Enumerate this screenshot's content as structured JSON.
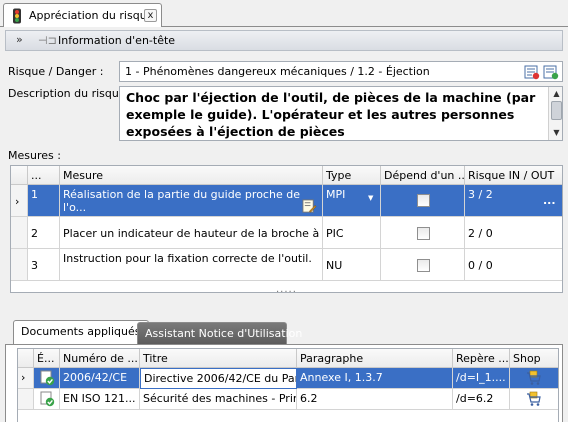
{
  "tab": {
    "title": "Appréciation du risque",
    "close": "x"
  },
  "header_section": {
    "label": "Information d'en-tête"
  },
  "risk": {
    "label": "Risque / Danger :",
    "value": "1 - Phénomènes dangereux mécaniques / 1.2 - Éjection"
  },
  "description": {
    "label": "Description du risque :",
    "text": "Choc par l'éjection de l'outil, de pièces de la machine (par exemple le guide). L'opérateur et les autres personnes exposées à l'éjection de pièces"
  },
  "measures": {
    "label": "Mesures :",
    "columns": [
      "...",
      "Mesure",
      "Type",
      "Dépend d'un ...",
      "Risque IN / OUT"
    ],
    "rows": [
      {
        "num": "1",
        "mesure": "Réalisation de la partie du guide proche de l'o...",
        "type": "MPI",
        "risk": "3 / 2",
        "selected": true
      },
      {
        "num": "2",
        "mesure": "Placer un indicateur de hauteur de la broche à pro...",
        "type": "PIC",
        "risk": "2 / 0",
        "selected": false
      },
      {
        "num": "3",
        "mesure": "Instruction pour la fixation correcte de l'outil.",
        "type": "NU",
        "risk": "0 / 0",
        "selected": false
      }
    ],
    "ellipsis": "..."
  },
  "subtabs": {
    "active": "Documents appliqués",
    "inactive": "Assistant Notice d'Utilisation"
  },
  "documents": {
    "columns": [
      "É...",
      "Numéro de ...",
      "Titre",
      "Paragraphe",
      "Repère ...",
      "Shop"
    ],
    "rows": [
      {
        "numero": "2006/42/CE",
        "titre": "Directive 2006/42/CE du Par...",
        "paragraphe": "Annexe I, 1.3.7",
        "repere": "/d=I_1....",
        "selected": true
      },
      {
        "numero": "EN ISO 121...",
        "titre": "Sécurité des machines - Prin...",
        "paragraphe": "6.2",
        "repere": "/d=6.2",
        "selected": false
      }
    ]
  },
  "colors": {
    "selection": "#3a6fc5",
    "accent_green": "#3aa34a",
    "header_bg": "#d9dde3"
  }
}
